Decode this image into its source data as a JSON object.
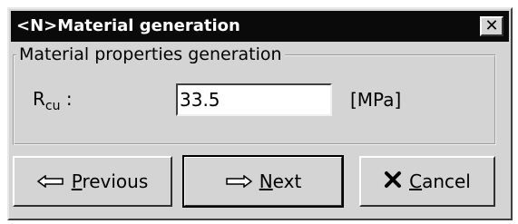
{
  "window": {
    "title": "<N>Material generation",
    "close_glyph": "✕"
  },
  "group": {
    "legend": "Material properties generation"
  },
  "field": {
    "label_main": "R",
    "label_sub": "cu",
    "label_suffix": " :",
    "value": "33.5",
    "unit": "[MPa]"
  },
  "buttons": {
    "previous": {
      "mnemonic": "P",
      "rest": "revious"
    },
    "next": {
      "mnemonic": "N",
      "rest": "ext"
    },
    "cancel": {
      "mnemonic": "C",
      "rest": "ancel"
    }
  },
  "colors": {
    "titlebar": "#0a0a0a",
    "window_bg": "#d4d4d4"
  }
}
